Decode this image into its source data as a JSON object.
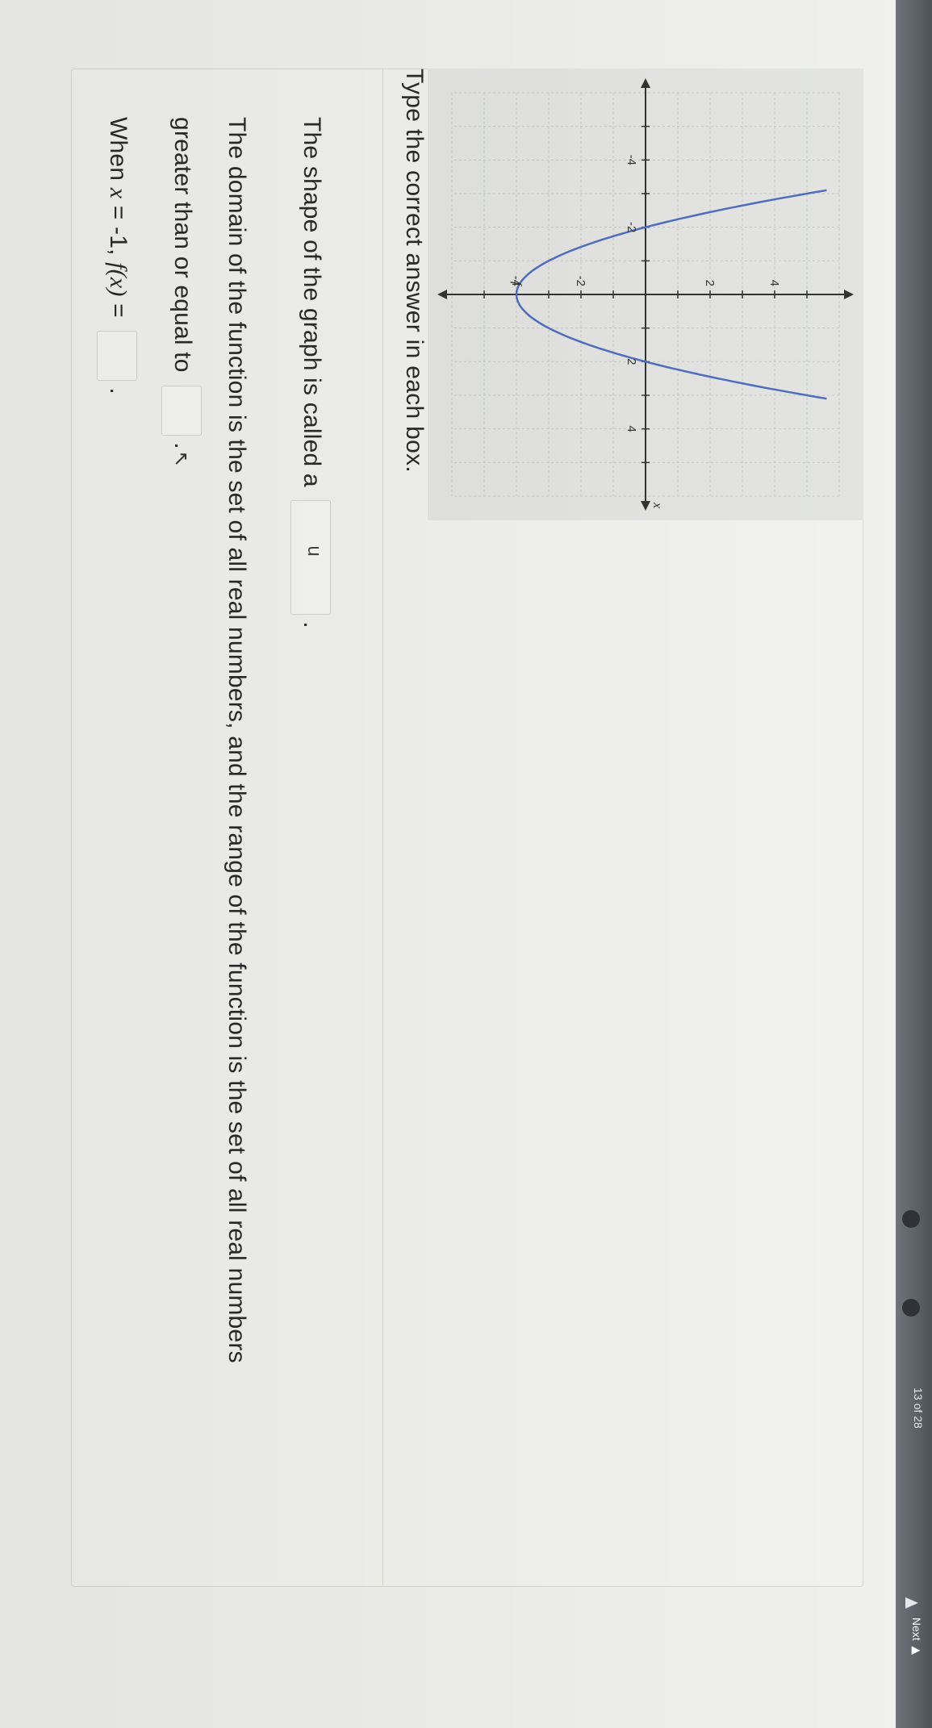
{
  "chrome": {
    "page_counter": "13 of 28",
    "action_label": "Next ▶"
  },
  "graph": {
    "x_axis_label": "x",
    "x_tick_labels": [
      "-4",
      "-2",
      "2",
      "4"
    ],
    "y_tick_labels": [
      "-4",
      "-2",
      "2",
      "4"
    ],
    "vertex_label": "f"
  },
  "chart_data": {
    "type": "line",
    "title": "",
    "xlabel": "x",
    "ylabel": "",
    "xlim": [
      -6,
      6
    ],
    "ylim": [
      -6,
      6
    ],
    "grid": true,
    "series": [
      {
        "function": "f(x) = x^2 - 4",
        "x": [
          -3,
          -2.5,
          -2,
          -1.5,
          -1,
          -0.5,
          0,
          0.5,
          1,
          1.5,
          2,
          2.5,
          3
        ],
        "y": [
          5,
          2.25,
          0,
          -1.75,
          -3,
          -3.75,
          -4,
          -3.75,
          -3,
          -1.75,
          0,
          2.25,
          5
        ],
        "color": "#4f6fbf"
      }
    ]
  },
  "question": {
    "instructions": "Type the correct answer in each box.",
    "line1_prefix": "The shape of the graph is called a",
    "line1_answer": "u",
    "line1_suffix": ".",
    "line2_text": "The domain of the function is the set of all real numbers, and the range of the function is the set of all real numbers",
    "line3_prefix": "greater than or equal to",
    "line3_answer": "",
    "line3_suffix": ".",
    "line4_prefix": "When",
    "line4_var": "x",
    "line4_equals": " = -1, ",
    "line4_fx": "f(x)",
    "line4_after": " =",
    "line4_answer": "",
    "line4_suffix": "."
  }
}
